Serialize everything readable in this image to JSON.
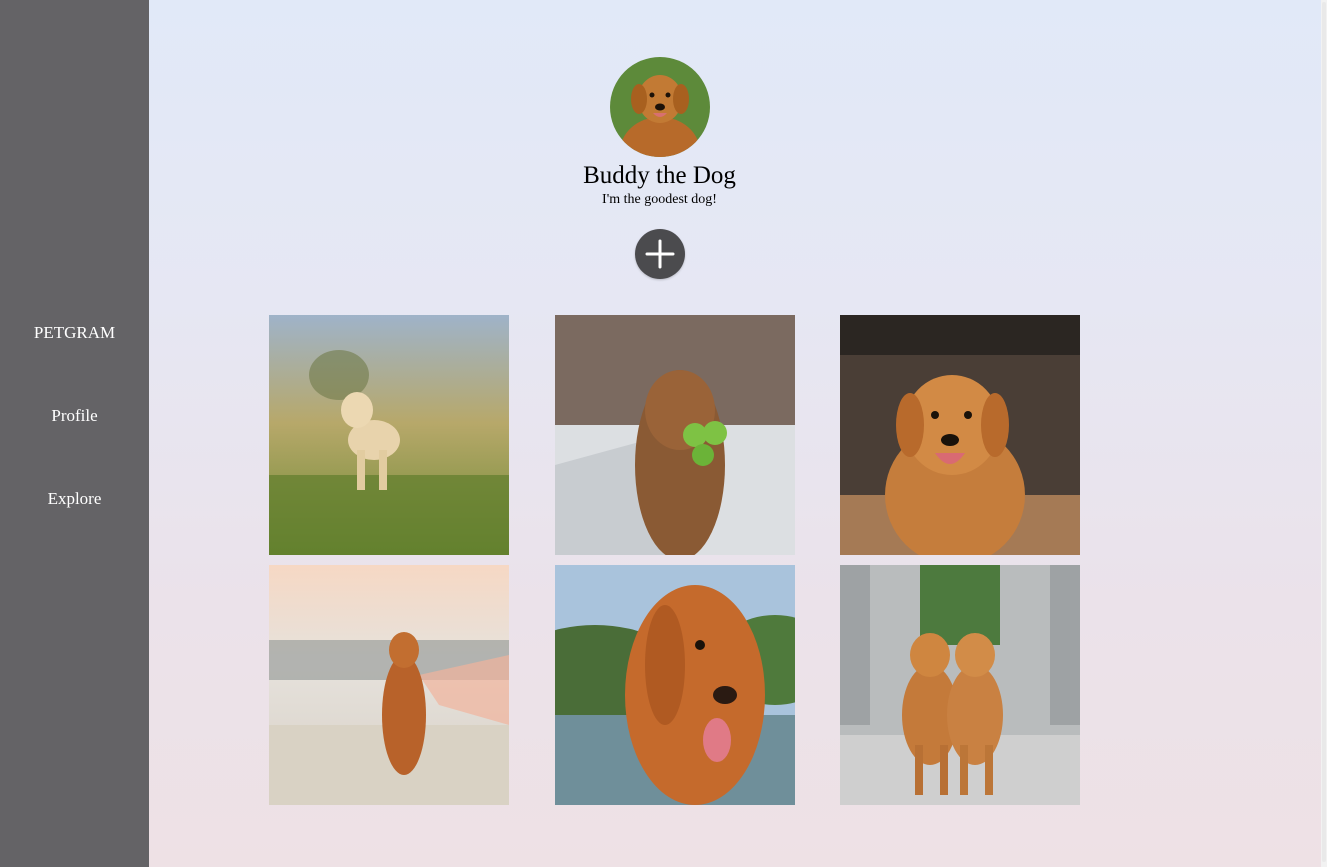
{
  "sidebar": {
    "brand": "PETGRAM",
    "items": [
      {
        "label": "Profile"
      },
      {
        "label": "Explore"
      }
    ]
  },
  "profile": {
    "name": "Buddy the Dog",
    "bio": "I'm the goodest dog!",
    "add_icon": "plus-icon"
  },
  "colors": {
    "sidebar_bg": "#646366",
    "add_button_bg": "#4b4b4e"
  },
  "gallery": [
    {
      "subject": "golden retriever puppy standing in grass"
    },
    {
      "subject": "golden retriever holding tennis balls in snow"
    },
    {
      "subject": "smiling golden retriever in cafe"
    },
    {
      "subject": "golden retriever sitting on beach at sunset"
    },
    {
      "subject": "golden retriever close-up by lake"
    },
    {
      "subject": "two golden retrievers standing together"
    }
  ]
}
